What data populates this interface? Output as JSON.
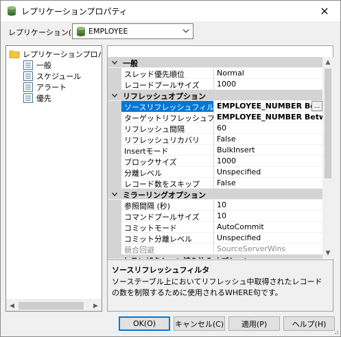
{
  "window": {
    "title": "レプリケーションプロパティ",
    "close_glyph": "✕"
  },
  "replication": {
    "label": "レプリケーション(R)",
    "value": "EMPLOYEE"
  },
  "tree": {
    "root": "レプリケーションプロパティ",
    "items": [
      "一般",
      "スケジュール",
      "アラート",
      "優先"
    ]
  },
  "grid": {
    "rows": [
      {
        "type": "cat",
        "label": "一般"
      },
      {
        "name": "スレッド優先順位",
        "value": "Normal"
      },
      {
        "name": "レコードプールサイズ",
        "value": "1000"
      },
      {
        "type": "cat",
        "label": "リフレッシュオプション"
      },
      {
        "name": "ソースリフレッシュフィルタ",
        "value": "EMPLOYEE_NUMBER Betwe",
        "selected": true,
        "bold": true,
        "ellipsis": "..."
      },
      {
        "name": "ターゲットリフレッシュフィルタ",
        "value": "EMPLOYEE_NUMBER Betwee",
        "bold": true
      },
      {
        "name": "リフレッシュ間隔",
        "value": "60"
      },
      {
        "name": "リフレッシュリカバリ",
        "value": "False"
      },
      {
        "name": "Insertモード",
        "value": "BulkInsert"
      },
      {
        "name": "ブロックサイズ",
        "value": "1000"
      },
      {
        "name": "分離レベル",
        "value": "Unspecified"
      },
      {
        "name": "レコード数をスキップ",
        "value": "False"
      },
      {
        "type": "cat",
        "label": "ミラーリングオプション"
      },
      {
        "name": "参照間隔 (秒)",
        "value": "10"
      },
      {
        "name": "コマンドプールサイズ",
        "value": "10"
      },
      {
        "name": "コミットモード",
        "value": "AutoCommit"
      },
      {
        "name": "コミット分離レベル",
        "value": "Unspecified"
      },
      {
        "name": "競合回避",
        "value": "SourceServerWins",
        "disabled": true
      },
      {
        "type": "cat",
        "label": "トランザクション読み込みオプション"
      }
    ]
  },
  "description": {
    "title": "ソースリフレッシュフィルタ",
    "text": "ソーステーブル上においてリフレッシュ中取得されたレコードの数を制限するために使用されるWHERE句です。"
  },
  "buttons": {
    "ok": "OK(O)",
    "cancel": "キャンセル(C)",
    "apply": "適用(P)",
    "help": "ヘルプ(H)"
  },
  "colors": {
    "selection": "#0078d7",
    "category_bg": "#d4d4d4",
    "folder": "#f5c342"
  }
}
